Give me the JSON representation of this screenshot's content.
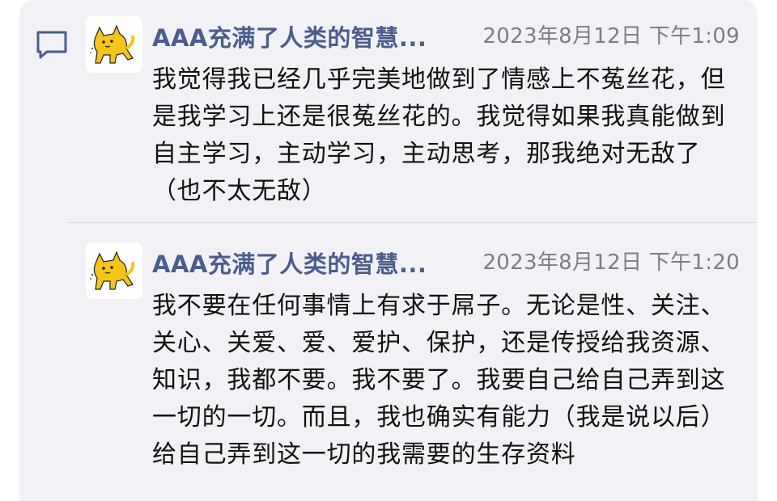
{
  "thread": {
    "messages": [
      {
        "author": "AAA充满了人类的智慧...",
        "timestamp": "2023年8月12日 下午1:09",
        "avatar_icon": "yellow-cat-icon",
        "text": "我觉得我已经几乎完美地做到了情感上不菟丝花，但是我学习上还是很菟丝花的。我觉得如果我真能做到自主学习，主动学习，主动思考，那我绝对无敌了（也不太无敌）"
      },
      {
        "author": "AAA充满了人类的智慧...",
        "timestamp": "2023年8月12日 下午1:20",
        "avatar_icon": "yellow-cat-icon",
        "text": "我不要在任何事情上有求于屌子。无论是性、关注、关心、关爱、爱、爱护、保护，还是传授给我资源、知识，我都不要。我不要了。我要自己给自己弄到这一切的一切。而且，我也确实有能力（我是说以后）给自己弄到这一切的我需要的生存资料"
      }
    ]
  },
  "colors": {
    "card_background": "#f2f2f6",
    "author_name": "#4a5d8c",
    "timestamp": "#7d7d85",
    "body_text": "#111111",
    "comment_icon": "#4a5d8c",
    "avatar_cat": "#f5c518"
  },
  "icons": {
    "thread": "comment-bubble-icon",
    "avatar": "yellow-cat-icon"
  }
}
